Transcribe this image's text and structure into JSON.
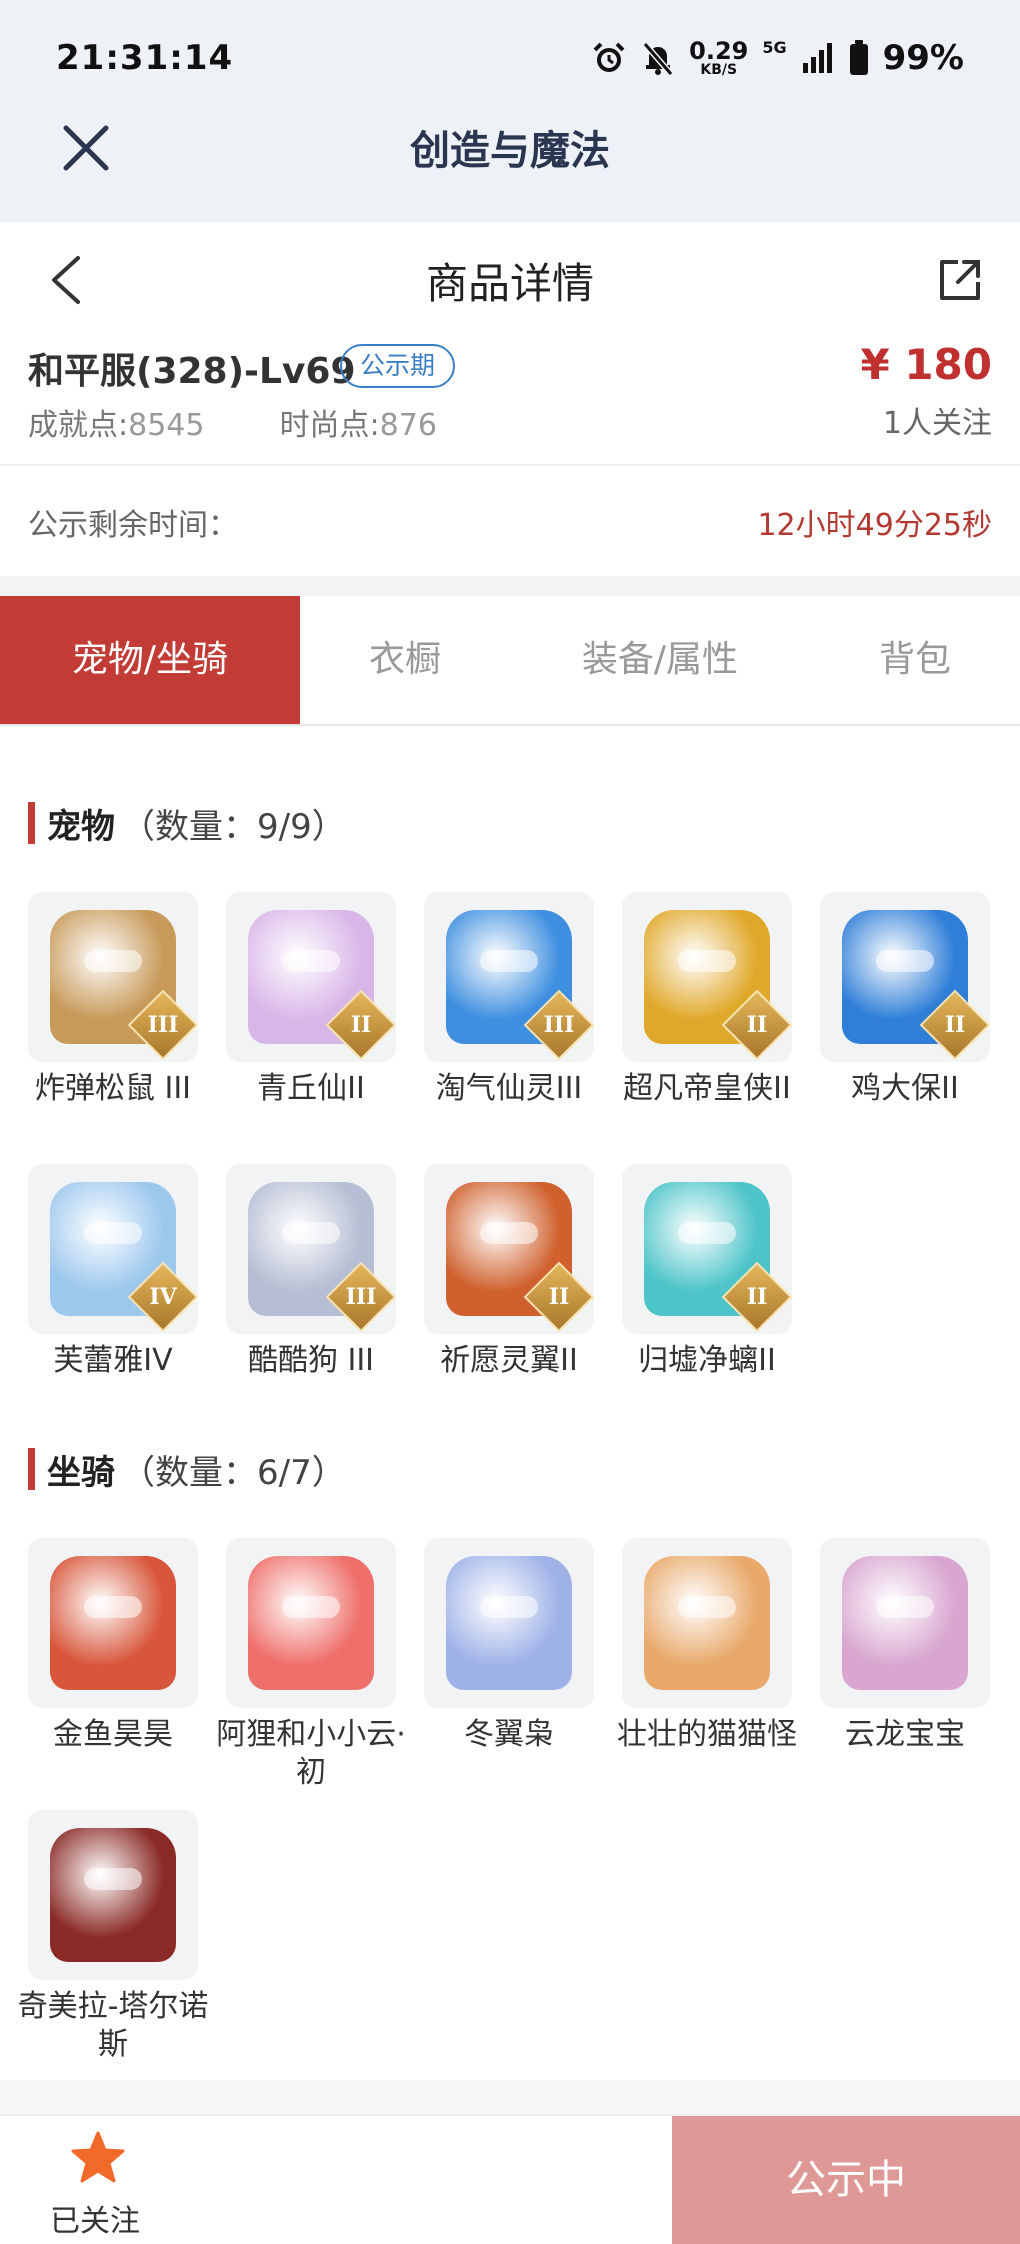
{
  "status_bar": {
    "time": "21:31:14",
    "speed": "0.29",
    "speed_unit": "KB/S",
    "network": "5G",
    "battery": "99%"
  },
  "app": {
    "title": "创造与魔法"
  },
  "page": {
    "title": "商品详情"
  },
  "product": {
    "name": "和平服(328)-Lv69",
    "badge": "公示期",
    "achievement_label": "成就点:",
    "achievement_value": "8545",
    "fashion_label": "时尚点:",
    "fashion_value": "876",
    "price": "¥ 180",
    "followers": "1人关注"
  },
  "timer": {
    "label": "公示剩余时间：",
    "value": "12小时49分25秒"
  },
  "tabs": [
    {
      "label": "宠物/坐骑",
      "active": true
    },
    {
      "label": "衣橱",
      "active": false
    },
    {
      "label": "装备/属性",
      "active": false
    },
    {
      "label": "背包",
      "active": false
    }
  ],
  "pets": {
    "title": "宠物",
    "count": "（数量：9/9）",
    "items": [
      {
        "name": "炸弹松鼠 III",
        "grade": "III",
        "color": "#c89a5a"
      },
      {
        "name": "青丘仙II",
        "grade": "II",
        "color": "#d9b6e8"
      },
      {
        "name": "淘气仙灵III",
        "grade": "III",
        "color": "#3f8fe0"
      },
      {
        "name": "超凡帝皇侠II",
        "grade": "II",
        "color": "#e0a82a"
      },
      {
        "name": "鸡大保II",
        "grade": "II",
        "color": "#2f7ed8"
      },
      {
        "name": "芙蕾雅IV",
        "grade": "IV",
        "color": "#9cc8ee"
      },
      {
        "name": "酷酷狗 III",
        "grade": "III",
        "color": "#b6bed4"
      },
      {
        "name": "祈愿灵翼II",
        "grade": "II",
        "color": "#d0612e"
      },
      {
        "name": "归墟净螭II",
        "grade": "II",
        "color": "#4cc4c8"
      }
    ]
  },
  "mounts": {
    "title": "坐骑",
    "count": "（数量：6/7）",
    "items": [
      {
        "name": "金鱼昊昊",
        "color": "#d8563a"
      },
      {
        "name": "阿狸和小小云·初",
        "color": "#ef6f6a"
      },
      {
        "name": "冬翼枭",
        "color": "#9fb2e8"
      },
      {
        "name": "壮壮的猫猫怪",
        "color": "#e8a96a"
      },
      {
        "name": "云龙宝宝",
        "color": "#d8a6d0"
      },
      {
        "name": "奇美拉-塔尔诺斯",
        "color": "#8a2a26"
      }
    ]
  },
  "bottom": {
    "follow_label": "已关注",
    "cta_label": "公示中"
  },
  "colors": {
    "accent": "#c23b35",
    "price": "#c0302e",
    "timer": "#b23a32",
    "badge": "#3a7fc6",
    "cta_bg": "#de9996",
    "star": "#f26a2a"
  }
}
